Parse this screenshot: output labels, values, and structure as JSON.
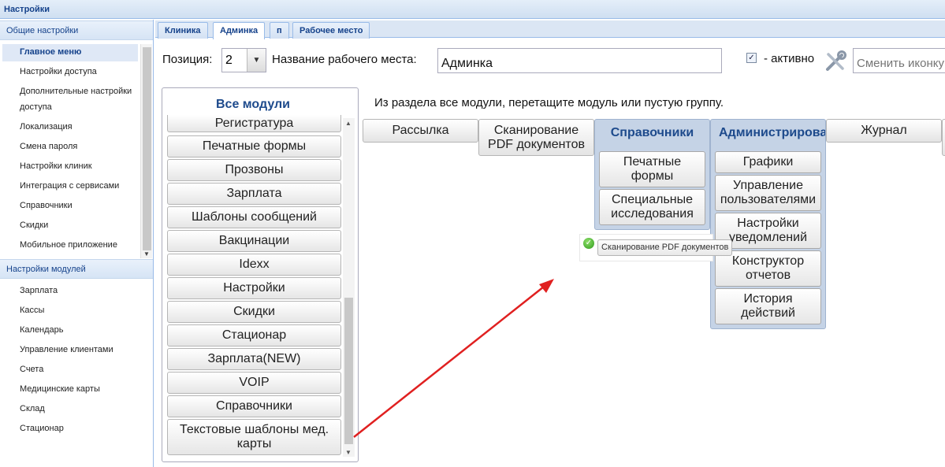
{
  "window": {
    "title": "Настройки"
  },
  "sidebar": {
    "general_header": "Общие настройки",
    "general_items": [
      "Главное меню",
      "Настройки доступа",
      "Дополнительные настройки",
      "доступа",
      "Локализация",
      "Смена пароля",
      "Настройки клиник",
      "Интеграция с сервисами",
      "Справочники",
      "Скидки",
      "Мобильное приложение"
    ],
    "modules_header": "Настройки модулей",
    "module_items": [
      "Зарплата",
      "Кассы",
      "Календарь",
      "Управление клиентами",
      "Счета",
      "Медицинские карты",
      "Склад",
      "Стационар"
    ]
  },
  "tabs": [
    "Клиника",
    "Админка",
    "п",
    "Рабочее место"
  ],
  "toolbar": {
    "position_label": "Позиция:",
    "position_value": "2",
    "name_label": "Название рабочего места:",
    "name_value": "Админка",
    "active_label": "- активно",
    "icon_placeholder": "Сменить иконку"
  },
  "all_modules": {
    "title": "Все модули",
    "items": [
      "Регистратура",
      "Печатные формы",
      "Прозвоны",
      "Зарплата",
      "Шаблоны сообщений",
      "Вакцинации",
      "Idexx",
      "Настройки",
      "Скидки",
      "Стационар",
      "Зарплата(NEW)",
      "VOIP",
      "Справочники",
      "Текстовые шаблоны мед. карты"
    ]
  },
  "hint": "Из раздела все модули, перетащите модуль или пустую группу.",
  "menu": {
    "mailing": "Рассылка",
    "pdf_scan": "Сканирование PDF документов",
    "journal": "Журнал",
    "group_reference": {
      "title": "Справочники",
      "items": [
        "Печатные формы",
        "Специальные исследования"
      ]
    },
    "group_admin": {
      "title": "Администрирование",
      "items": [
        "Графики",
        "Управление пользователями",
        "Настройки уведомлений",
        "Конструктор отчетов",
        "История действий"
      ]
    }
  },
  "drag_proxy": {
    "label": "Сканирование PDF документов"
  },
  "colors": {
    "accent": "#15428b",
    "group_bg": "#c5d3e6",
    "arrow": "#e02020"
  }
}
